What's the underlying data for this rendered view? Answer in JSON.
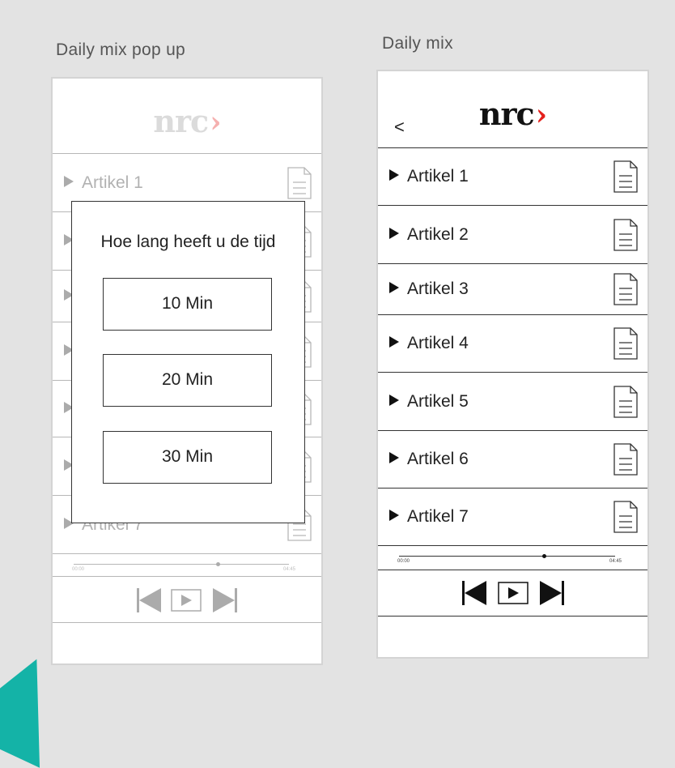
{
  "boards": {
    "popup_label": "Daily mix pop up",
    "list_label": "Daily mix"
  },
  "app": {
    "logo_text": "nrc",
    "logo_chevron": "›",
    "back_glyph": "<"
  },
  "articles": [
    "Artikel 1",
    "Artikel 2",
    "Artikel 3",
    "Artikel 4",
    "Artikel 5",
    "Artikel 6",
    "Artikel 7"
  ],
  "player": {
    "time_start": "00:00",
    "time_end": "04:45",
    "progress": 0.67
  },
  "popup": {
    "question": "Hoe lang heeft u de tijd",
    "options": [
      "10 Min",
      "20 Min",
      "30 Min"
    ]
  },
  "colors": {
    "brand_red": "#e4211c",
    "accent_teal": "#14b3a7"
  },
  "icons": [
    "document-icon",
    "play-icon",
    "skip-back-icon",
    "skip-forward-icon",
    "back-chevron-icon"
  ]
}
